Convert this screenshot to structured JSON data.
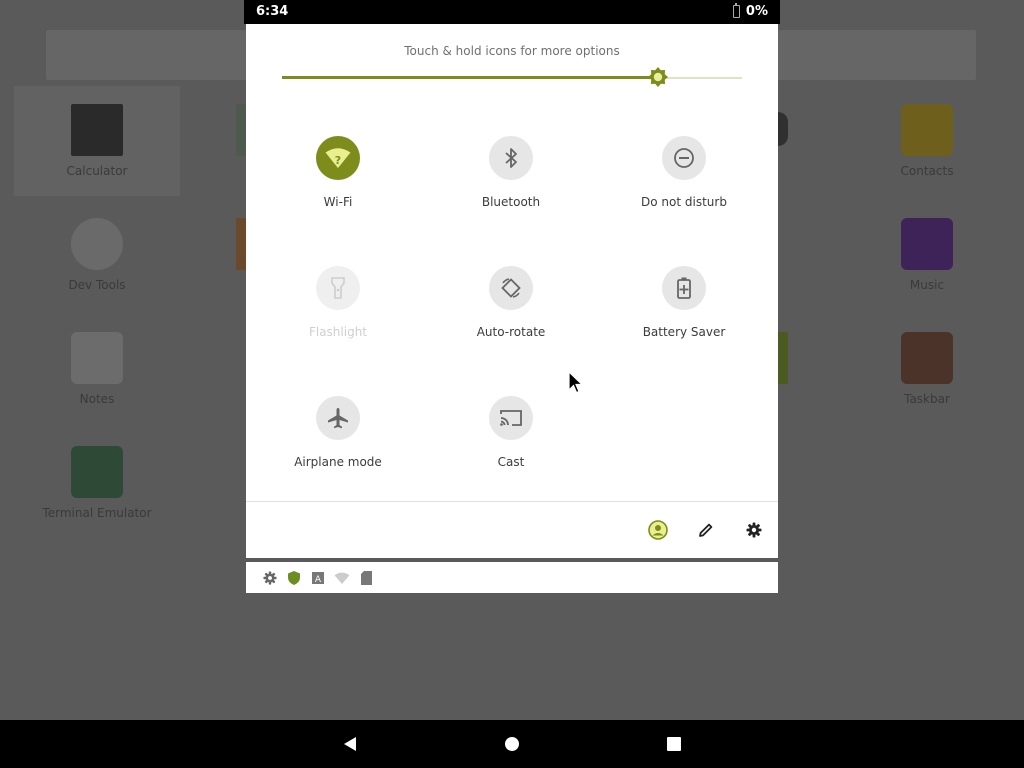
{
  "status_bar": {
    "time": "6:34",
    "battery": "0%"
  },
  "quick_settings": {
    "hint": "Touch & hold icons for more options",
    "brightness": 0.817,
    "tiles": [
      {
        "label": "Wi-Fi",
        "icon": "wifi-unknown-icon",
        "state": "on"
      },
      {
        "label": "Bluetooth",
        "icon": "bluetooth-icon",
        "state": "off"
      },
      {
        "label": "Do not disturb",
        "icon": "do-not-disturb-icon",
        "state": "off"
      },
      {
        "label": "Flashlight",
        "icon": "flashlight-icon",
        "state": "unavailable"
      },
      {
        "label": "Auto-rotate",
        "icon": "auto-rotate-icon",
        "state": "off"
      },
      {
        "label": "Battery Saver",
        "icon": "battery-saver-icon",
        "state": "off"
      },
      {
        "label": "Airplane mode",
        "icon": "airplane-icon",
        "state": "off"
      },
      {
        "label": "Cast",
        "icon": "cast-icon",
        "state": "off"
      }
    ],
    "footer": [
      "user-icon",
      "edit-icon",
      "settings-gear-icon"
    ]
  },
  "notification_icons": [
    "settings-icon",
    "shield-icon",
    "text-a-icon",
    "wifi-icon",
    "sd-card-icon"
  ],
  "launcher": {
    "apps": [
      {
        "label": "Calculator"
      },
      {
        "label": "Contacts"
      },
      {
        "label": "Dev Tools"
      },
      {
        "label": "Music"
      },
      {
        "label": "Notes"
      },
      {
        "label": "Taskbar"
      },
      {
        "label": "Terminal Emulator"
      }
    ]
  },
  "colors": {
    "accent": "#7d8c1a",
    "tile_off": "#e6e6e6",
    "panel": "#ffffff",
    "scrim": "#575757"
  },
  "navigation": [
    "back-button",
    "home-button",
    "recents-button"
  ]
}
